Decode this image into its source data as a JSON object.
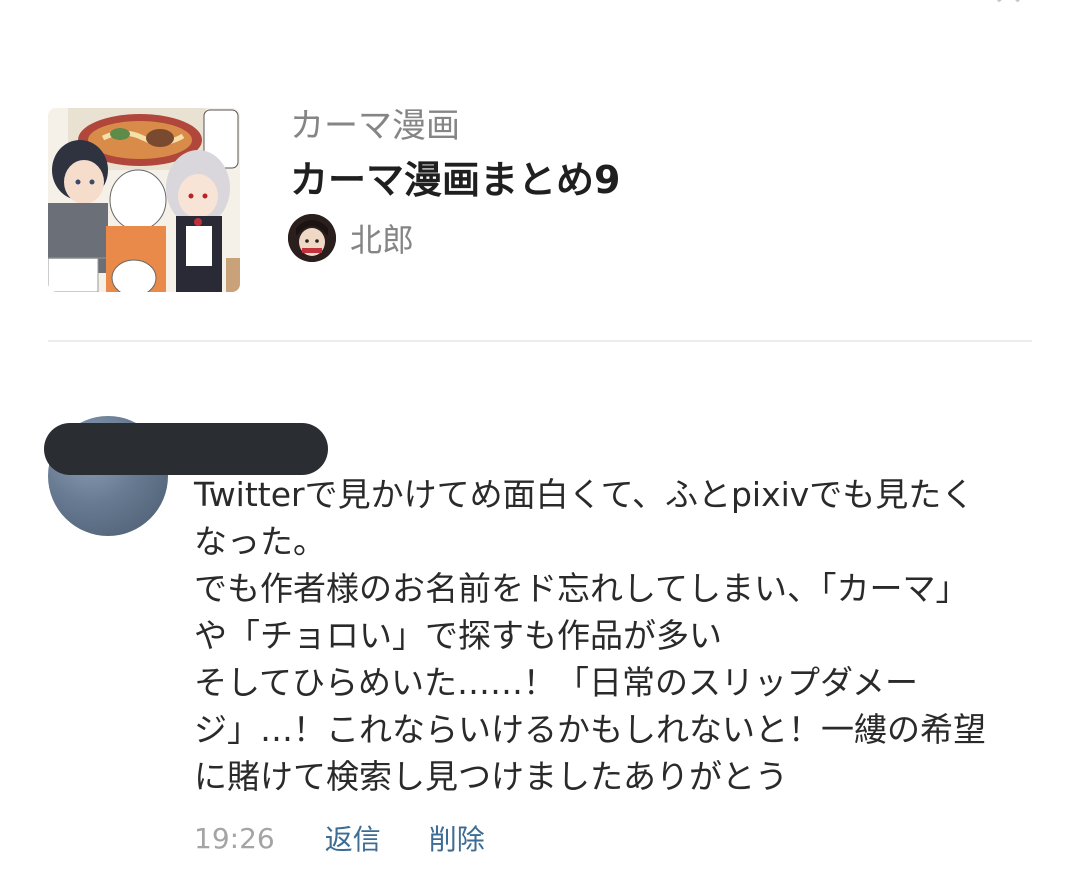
{
  "work": {
    "series": "カーマ漫画",
    "title": "カーマ漫画まとめ9",
    "author_name": "北郎"
  },
  "comment": {
    "lines": [
      "Twitterで見かけてめ面白くて、ふとpixivでも見たく",
      "なった。",
      "でも作者様のお名前をド忘れしてしまい、「カーマ」",
      "や「チョロい」で探すも作品が多い",
      "そしてひらめいた……！「日常のスリップダメー",
      "ジ」…！これならいけるかもしれないと！一縷の希望",
      "に賭けて検索し見つけましたありがとう"
    ],
    "time": "19:26",
    "reply_label": "返信",
    "delete_label": "削除"
  },
  "colors": {
    "link": "#3d6c94",
    "muted_text": "#858585",
    "timestamp": "#a4a4a4",
    "redaction": "#2a2d31",
    "divider": "#ececec"
  }
}
